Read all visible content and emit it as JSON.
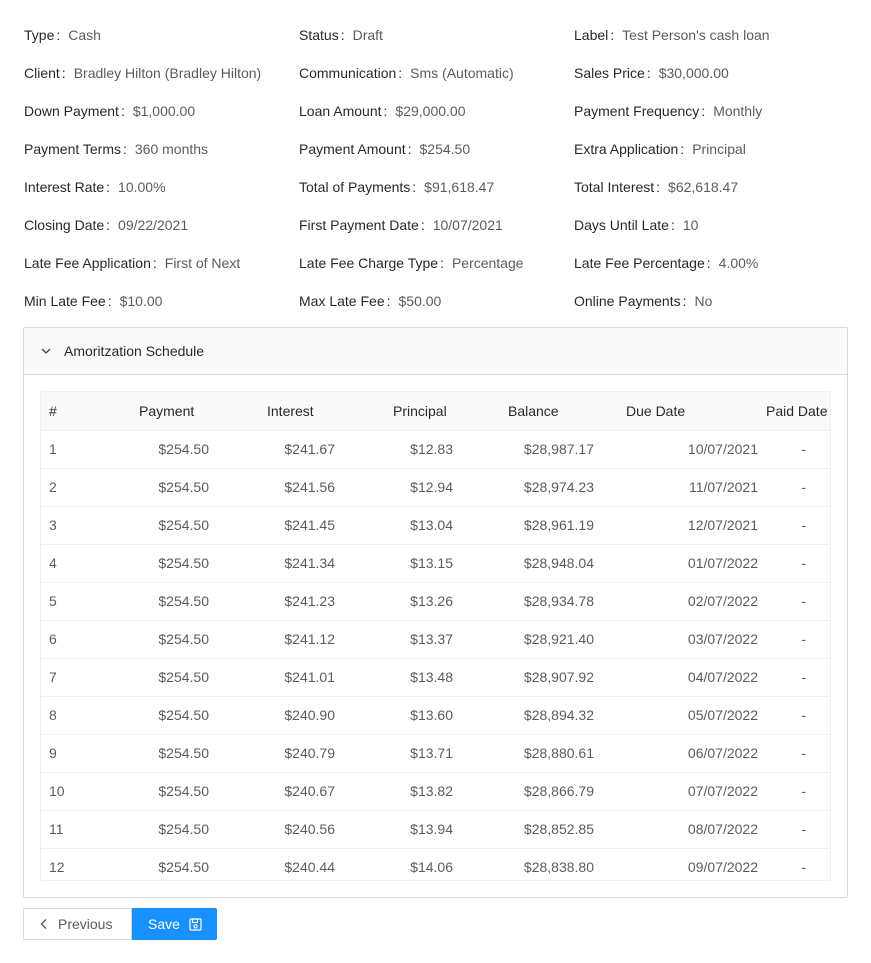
{
  "details": [
    {
      "label": "Type",
      "value": "Cash"
    },
    {
      "label": "Status",
      "value": "Draft"
    },
    {
      "label": "Label",
      "value": "Test Person's cash loan"
    },
    {
      "label": "Client",
      "value": "Bradley Hilton (Bradley Hilton)"
    },
    {
      "label": "Communication",
      "value": "Sms (Automatic)"
    },
    {
      "label": "Sales Price",
      "value": "$30,000.00"
    },
    {
      "label": "Down Payment",
      "value": "$1,000.00"
    },
    {
      "label": "Loan Amount",
      "value": "$29,000.00"
    },
    {
      "label": "Payment Frequency",
      "value": "Monthly"
    },
    {
      "label": "Payment Terms",
      "value": "360 months"
    },
    {
      "label": "Payment Amount",
      "value": "$254.50"
    },
    {
      "label": "Extra Application",
      "value": "Principal"
    },
    {
      "label": "Interest Rate",
      "value": "10.00%"
    },
    {
      "label": "Total of Payments",
      "value": "$91,618.47"
    },
    {
      "label": "Total Interest",
      "value": "$62,618.47"
    },
    {
      "label": "Closing Date",
      "value": "09/22/2021"
    },
    {
      "label": "First Payment Date",
      "value": "10/07/2021"
    },
    {
      "label": "Days Until Late",
      "value": "10"
    },
    {
      "label": "Late Fee Application",
      "value": "First of Next"
    },
    {
      "label": "Late Fee Charge Type",
      "value": "Percentage"
    },
    {
      "label": "Late Fee Percentage",
      "value": "4.00%"
    },
    {
      "label": "Min Late Fee",
      "value": "$10.00"
    },
    {
      "label": "Max Late Fee",
      "value": "$50.00"
    },
    {
      "label": "Online Payments",
      "value": "No"
    }
  ],
  "detail_colon": ":",
  "schedule": {
    "title": "Amoritzation Schedule",
    "expanded_icon": "chevron-down-icon",
    "columns": [
      "#",
      "Payment",
      "Interest",
      "Principal",
      "Balance",
      "Due Date",
      "Paid Date"
    ],
    "rows": [
      [
        "1",
        "$254.50",
        "$241.67",
        "$12.83",
        "$28,987.17",
        "10/07/2021",
        "-"
      ],
      [
        "2",
        "$254.50",
        "$241.56",
        "$12.94",
        "$28,974.23",
        "11/07/2021",
        "-"
      ],
      [
        "3",
        "$254.50",
        "$241.45",
        "$13.04",
        "$28,961.19",
        "12/07/2021",
        "-"
      ],
      [
        "4",
        "$254.50",
        "$241.34",
        "$13.15",
        "$28,948.04",
        "01/07/2022",
        "-"
      ],
      [
        "5",
        "$254.50",
        "$241.23",
        "$13.26",
        "$28,934.78",
        "02/07/2022",
        "-"
      ],
      [
        "6",
        "$254.50",
        "$241.12",
        "$13.37",
        "$28,921.40",
        "03/07/2022",
        "-"
      ],
      [
        "7",
        "$254.50",
        "$241.01",
        "$13.48",
        "$28,907.92",
        "04/07/2022",
        "-"
      ],
      [
        "8",
        "$254.50",
        "$240.90",
        "$13.60",
        "$28,894.32",
        "05/07/2022",
        "-"
      ],
      [
        "9",
        "$254.50",
        "$240.79",
        "$13.71",
        "$28,880.61",
        "06/07/2022",
        "-"
      ],
      [
        "10",
        "$254.50",
        "$240.67",
        "$13.82",
        "$28,866.79",
        "07/07/2022",
        "-"
      ],
      [
        "11",
        "$254.50",
        "$240.56",
        "$13.94",
        "$28,852.85",
        "08/07/2022",
        "-"
      ],
      [
        "12",
        "$254.50",
        "$240.44",
        "$14.06",
        "$28,838.80",
        "09/07/2022",
        "-"
      ]
    ]
  },
  "footer": {
    "previous_label": "Previous",
    "previous_icon": "chevron-left-icon",
    "save_label": "Save",
    "save_icon": "save-icon"
  },
  "colors": {
    "primary": "#1890ff",
    "border": "#d9d9d9",
    "header_bg": "#fafafa"
  }
}
